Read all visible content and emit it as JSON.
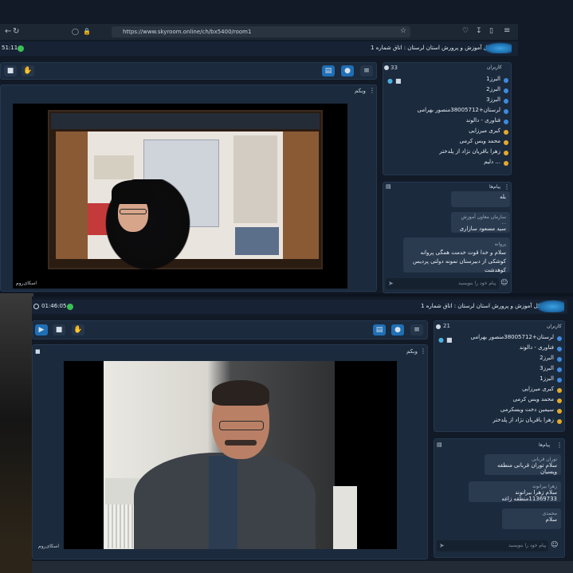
{
  "top_window": {
    "clock": "51:11",
    "url": "https://www.skyroom.online/ch/bx5400/room1",
    "title": "اداره کل آموزش و پرورش استان لرستان : اتاق شماره 1",
    "webcam_label": "وبکم",
    "users_panel": {
      "title": "کاربران",
      "count": "33",
      "users": [
        "البرز1",
        "البرز2",
        "البرز3",
        "لرستان+38005712منصور بهرامی",
        "فناوری - دالوند",
        "کبری میرزایی",
        "محمد ویس کرمی",
        "زهرا باقریان نژاد از پلدختر",
        "دلیم ..."
      ]
    },
    "messages_panel": {
      "title": "پیام‌ها",
      "messages": [
        {
          "sender": "",
          "text": "بله"
        },
        {
          "sender": "سازمان معاون آموزش ...",
          "text": "سید مسعود سازاری"
        },
        {
          "sender": "پروانه",
          "text": "سلام و خدا قوت خدمت همگی پروانه کوشکی از دبیرستان نمونه دولتی پردیس کوهدشت"
        }
      ],
      "input_placeholder": "پیام خود را بنویسید"
    },
    "video_watermark": "اسکای‌روم"
  },
  "bottom_window": {
    "clock": "01:46:05",
    "title": "اداره کل آموزش و پرورش استان لرستان : اتاق شماره 1",
    "webcam_label": "وبکم",
    "users_panel": {
      "title": "کاربران",
      "count": "21",
      "users": [
        "لرستان+38005712منصور بهرامی",
        "فناوری - دالوند",
        "البرز2",
        "البرز3",
        "البرز1",
        "کبری میرزایی",
        "محمد ویس کرمی",
        "سیمین دخت ویسکرمی",
        "زهرا باقریان نژاد از پلدختر"
      ]
    },
    "messages_panel": {
      "title": "پیام‌ها",
      "messages": [
        {
          "sender": "توران قربانی",
          "text": "سلام توران قربانی منطقه ویسیان"
        },
        {
          "sender": "زهرا بیرانوند",
          "text": "سلام زهرا بیرانوند 11369733منطقه زاغه"
        },
        {
          "sender": "محمدی",
          "text": "سلام"
        }
      ],
      "input_placeholder": "پیام خود را بنویسید"
    },
    "video_watermark": "اسکای‌روم"
  }
}
